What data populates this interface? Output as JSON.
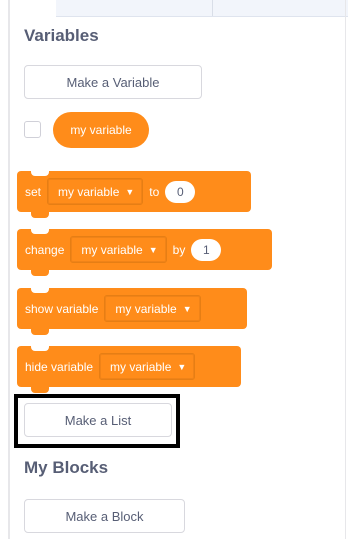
{
  "palette": {
    "heading_text": "#575e75",
    "variable_block": "#ff8c1a",
    "block_text": "#ffffff",
    "highlight_border": "#000000"
  },
  "variables": {
    "heading": "Variables",
    "make_variable_label": "Make a Variable",
    "variable_reporter": {
      "name": "my variable",
      "checkbox_checked": false
    },
    "blocks": {
      "set": {
        "label": "set",
        "dropdown": "my variable",
        "connector": "to",
        "value": "0"
      },
      "change": {
        "label": "change",
        "dropdown": "my variable",
        "connector": "by",
        "value": "1"
      },
      "show": {
        "label": "show variable",
        "dropdown": "my variable"
      },
      "hide": {
        "label": "hide variable",
        "dropdown": "my variable"
      }
    },
    "make_list_label": "Make a List"
  },
  "my_blocks": {
    "heading": "My Blocks",
    "make_block_label": "Make a Block"
  },
  "icons": {
    "dropdown_arrow": "chevron-down-icon"
  }
}
